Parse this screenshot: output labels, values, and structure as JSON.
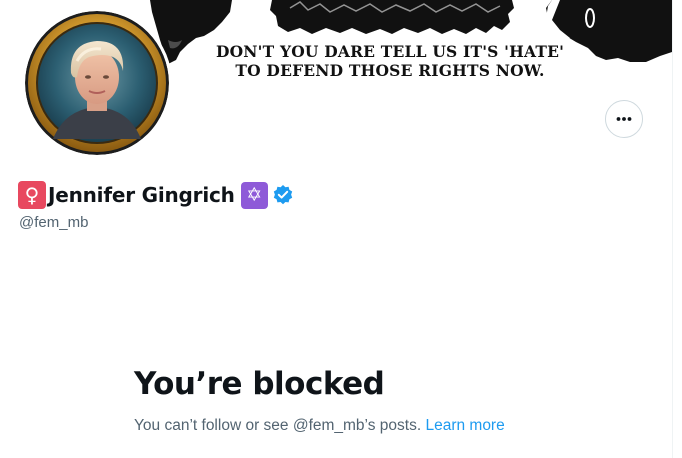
{
  "banner": {
    "line1": "DON'T YOU DARE TELL US IT'S 'HATE'",
    "line2": "TO DEFEND THOSE RIGHTS NOW."
  },
  "profile": {
    "name_prefix_emoji": "♀",
    "display_name": "Jennifer Gingrich",
    "name_suffix_emoji": "✡",
    "handle": "@fem_mb",
    "verified": true
  },
  "actions": {
    "more_icon": "more-horizontal-icon"
  },
  "blocked": {
    "title": "You’re blocked",
    "message": "You can’t follow or see @fem_mb’s posts.",
    "link": "Learn more"
  },
  "colors": {
    "link": "#1d9bf0",
    "verified": "#1d9bf0",
    "text_primary": "#0f1419",
    "text_secondary": "#536471"
  }
}
